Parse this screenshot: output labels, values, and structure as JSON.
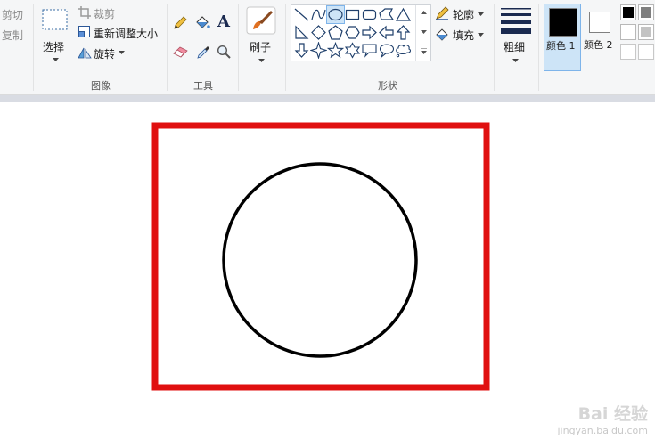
{
  "clipboard": {
    "cut": "剪切",
    "copy": "复制"
  },
  "image": {
    "select": "选择",
    "crop": "裁剪",
    "resize": "重新调整大小",
    "rotate": "旋转",
    "group_label": "图像"
  },
  "tools": {
    "group_label": "工具",
    "text_tool_glyph": "A"
  },
  "brushes": {
    "label": "刷子"
  },
  "shapes": {
    "group_label": "形状",
    "outline": "轮廓",
    "fill": "填充",
    "items": [
      "line",
      "curve",
      "oval",
      "rectangle",
      "rounded-rectangle",
      "polygon",
      "triangle",
      "right-triangle",
      "diamond",
      "pentagon",
      "hexagon",
      "arrow-right",
      "arrow-left",
      "arrow-up",
      "arrow-down",
      "star-four",
      "star-five",
      "star-six",
      "callout-rect",
      "callout-oval",
      "callout-cloud"
    ],
    "selected": "oval"
  },
  "size": {
    "label": "粗细"
  },
  "colors": {
    "color1_label": "颜色 1",
    "color2_label": "颜色 2",
    "color1": "#000000",
    "color2": "#ffffff",
    "palette": [
      "#000000",
      "#7f7f7f",
      "#ffffff",
      "#c3c3c3",
      "#ffffff",
      "#ffffff"
    ]
  },
  "canvas": {
    "rect_color": "#e01010",
    "circle_color": "#000000"
  },
  "watermark": {
    "brand": "Bai 经验",
    "url": "jingyan.baidu.com"
  }
}
